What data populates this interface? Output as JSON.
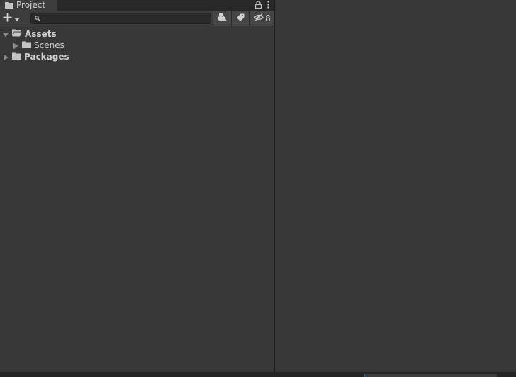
{
  "tab": {
    "title": "Project",
    "icon": "folder-icon"
  },
  "tab_controls": {
    "lock_icon": "lock-icon",
    "menu_icon": "kebab-menu-icon"
  },
  "toolbar": {
    "create_icon": "plus-icon",
    "search": {
      "value": "",
      "placeholder": ""
    },
    "type_filter_icon": "shapes-icon",
    "label_filter_icon": "tag-icon",
    "hidden_packages_count": "8"
  },
  "tree": {
    "items": [
      {
        "label": "Assets",
        "expanded": true,
        "depth": 0
      },
      {
        "label": "Scenes",
        "expanded": false,
        "depth": 1
      },
      {
        "label": "Packages",
        "expanded": false,
        "depth": 0
      }
    ]
  },
  "colors": {
    "panel_bg": "#383838",
    "toolbar_bg": "#3c3c3c",
    "tab_strip_bg": "#282828",
    "divider": "#1c1c1c",
    "text": "#d2d2d2",
    "icon": "#c4c4c4"
  }
}
